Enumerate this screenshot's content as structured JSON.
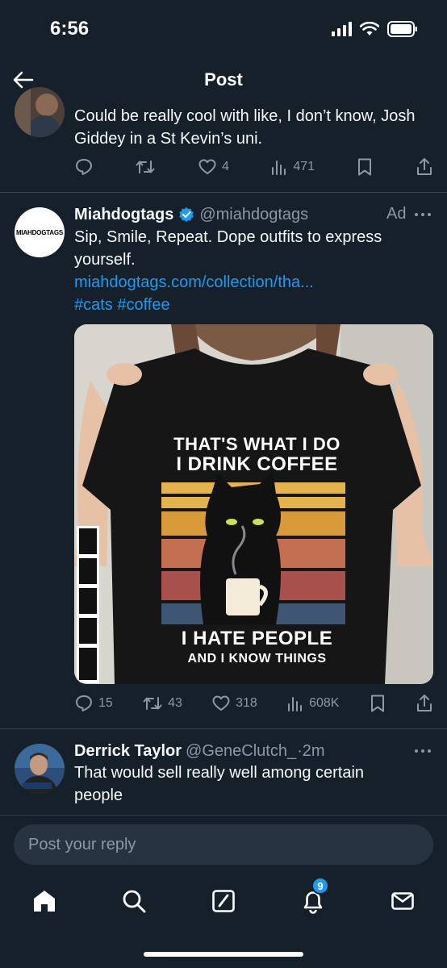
{
  "status": {
    "time": "6:56"
  },
  "header": {
    "title": "Post"
  },
  "prev_post": {
    "text": "Could be really cool with like, I don’t know, Josh Giddey in a St Kevin’s uni.",
    "likes": "4",
    "views": "471"
  },
  "ad_post": {
    "avatar_text": "MIAHDOGTAGS",
    "name": "Miahdogtags",
    "handle": "@miahdogtags",
    "ad_label": "Ad",
    "text": "Sip, Smile, Repeat. Dope outfits to express yourself.",
    "link": "miahdogtags.com/collection/tha...",
    "hashtags": "#cats #coffee",
    "shirt_line1": "THAT'S WHAT I DO",
    "shirt_line2": "I DRINK COFFEE",
    "shirt_line3": "I HATE PEOPLE",
    "shirt_line4": "AND I KNOW THINGS",
    "replies": "15",
    "reposts": "43",
    "likes": "318",
    "views": "608K"
  },
  "reply_post": {
    "name": "Derrick Taylor",
    "handle": "@GeneClutch_",
    "time": "·2m",
    "text": "That would sell really well among certain people"
  },
  "reply_input": {
    "placeholder": "Post your reply"
  },
  "tabbar": {
    "notifications_badge": "9"
  },
  "colors": {
    "background": "#15202b",
    "accent": "#1d9bf0",
    "muted": "#8b98a5",
    "divider": "#38444d"
  }
}
